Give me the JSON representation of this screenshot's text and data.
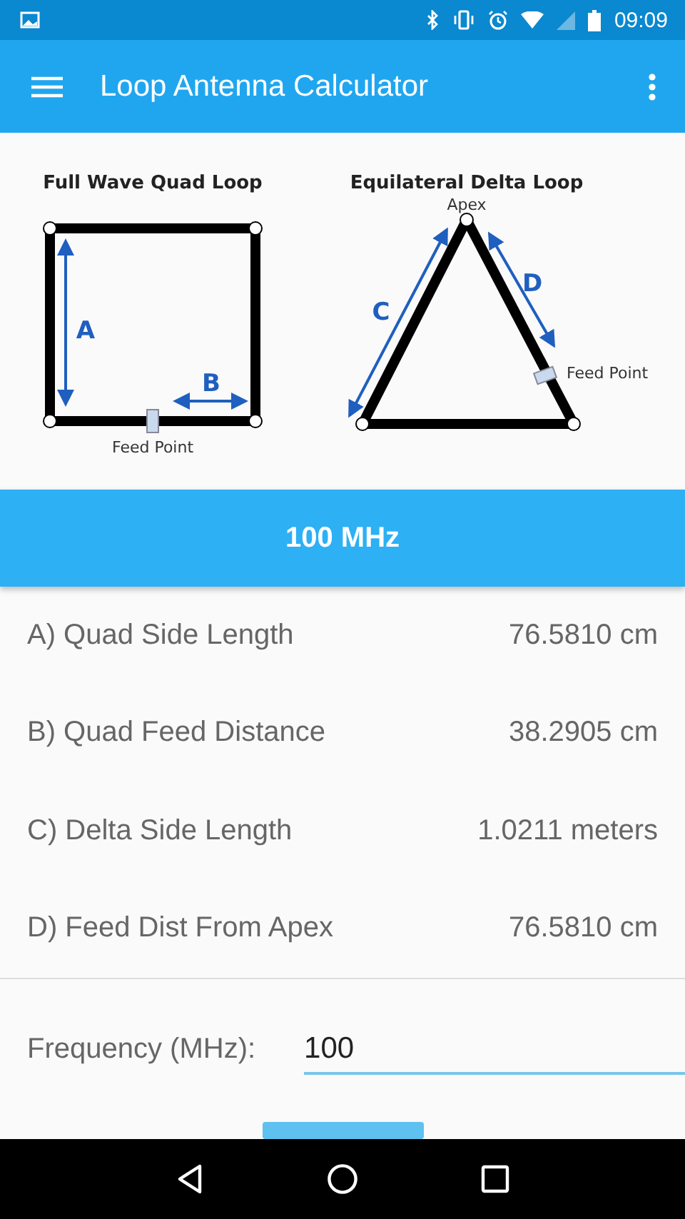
{
  "status_bar": {
    "time": "09:09"
  },
  "toolbar": {
    "title": "Loop Antenna Calculator"
  },
  "diagrams": {
    "quad_title": "Full Wave Quad Loop",
    "delta_title": "Equilateral Delta Loop",
    "label_a": "A",
    "label_b": "B",
    "label_c": "C",
    "label_d": "D",
    "quad_feed": "Feed Point",
    "delta_feed": "Feed Point",
    "apex": "Apex"
  },
  "banner": {
    "text": "100 MHz"
  },
  "results": [
    {
      "label": "A) Quad Side Length",
      "value": "76.5810 cm"
    },
    {
      "label": "B) Quad Feed Distance",
      "value": "38.2905 cm"
    },
    {
      "label": "C) Delta Side Length",
      "value": "1.0211 meters"
    },
    {
      "label": "D) Feed Dist From Apex",
      "value": "76.5810 cm"
    }
  ],
  "frequency": {
    "label": "Frequency (MHz):",
    "value": "100"
  }
}
